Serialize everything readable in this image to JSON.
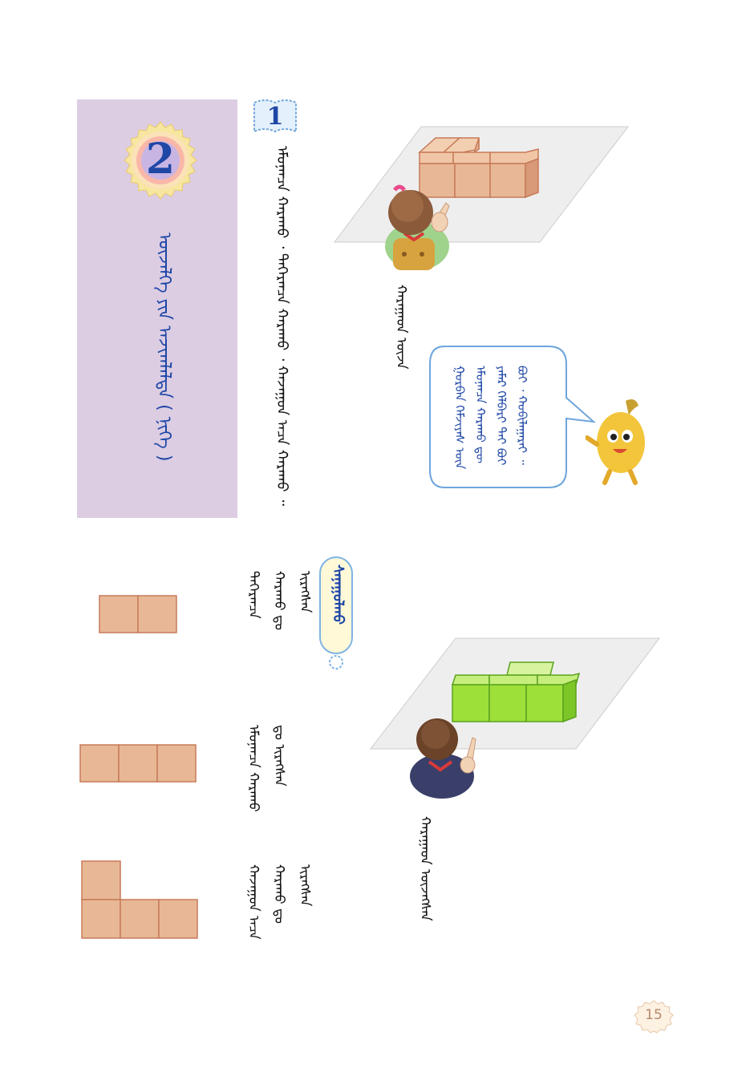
{
  "lesson": {
    "number": "2",
    "title": "ᠦᠵᠡᠯᠭᠡ ᠶᠢᠨ ᠠᠵᠢᠭᠯᠠᠯᠲᠠ ( ᠨᠢᠭᠡ )"
  },
  "exercise": {
    "number": "1",
    "instruction": "ᠡᠮᠦᠨᠡᠡᠴᠡ ᠬᠠᠷᠠᠬᠤ ᠂ ᠳᠡᠭᠡᠷᠡᠡᠴᠡ ᠬᠠᠷᠠᠬᠤ ᠂ ᠬᠠᠵᠠᠭᠤᠨ ᠠᠴᠠ ᠬᠠᠷᠠᠬᠤ ᠃"
  },
  "captions": {
    "girl": "ᠬᠠᠷᠠᠭᠠᠳ ᠦᠵᠡ",
    "boy": "ᠬᠠᠷᠠᠭᠠᠳ ᠦᠵᠡᠭᠰᠡᠨ"
  },
  "speech_bubble": {
    "text": "ᠭᠤᠷᠪᠠᠨ ᠬᠡᠮᠵᠢᠶᠡᠰ ᠦᠨ ᠡᠮᠦᠨᠡᠡᠴᠡ ᠬᠠᠷᠠᠬᠤ ᠳᠦ ᠶᠠᠮᠠᠷ ᠬᠡᠯᠪᠡᠷᠢ ᠲᠠᠢ ᠪᠤᠢ ᠪᠤᠢ ᠂ ᠬᠤᠪᠢᠯᠠᠭᠠᠷᠠᠢ ᠃"
  },
  "tip": {
    "label": "ᠰᠠᠨᠠᠭᠤᠯᠬᠤ"
  },
  "views": [
    {
      "label": "ᠳᠡᠭᠡᠷᠡᠡᠴᠡ ᠬᠠᠷᠠᠬᠤ ᠳᠤ ᠢᠷᠡᠭᠰᠡᠨ"
    },
    {
      "label": "ᠡᠮᠦᠨᠡᠡᠴᠡ ᠬᠠᠷᠠᠬᠤ ᠳᠤ ᠢᠷᠡᠭᠰᠡᠨ"
    },
    {
      "label": "ᠬᠠᠵᠠᠭᠤᠨ ᠠᠴᠠ ᠬᠠᠷᠠᠬᠤ ᠳᠤ ᠢᠷᠡᠭᠰᠡᠨ"
    }
  ],
  "page": {
    "number": "15"
  },
  "colors": {
    "header_band": "#dccde3",
    "accent_blue": "#1f47a6",
    "block_tan": "#e8b896",
    "block_green": "#9ee03a",
    "plane_grey": "#ececec"
  }
}
